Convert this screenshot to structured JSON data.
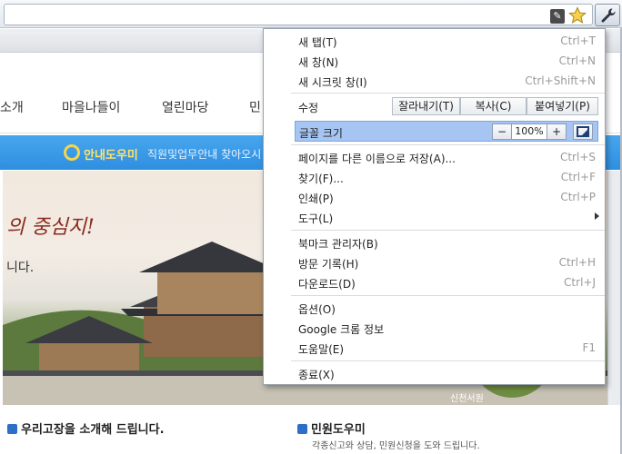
{
  "page": {
    "nav": [
      "소개",
      "마을나들이",
      "열린마당",
      "민"
    ],
    "guide_bar": {
      "title": "안내도우미",
      "links": "직원및업무안내 찾아오시"
    },
    "hero": {
      "slogan": "의 중심지!",
      "slogan2": "니다.",
      "caption": "신천서원"
    },
    "sections": [
      {
        "title": "우리고장을 소개해 드립니다."
      },
      {
        "title": "민원도우미",
        "desc": "각종신고와 상담, 민원신청을 도와 드립니다."
      }
    ]
  },
  "toolbar": {
    "page_action_icon": "page-action-icon",
    "star_icon": "bookmark-star-icon",
    "wrench_icon": "wrench-icon"
  },
  "menu": {
    "new_tab": {
      "label": "새 탭(T)",
      "shortcut": "Ctrl+T"
    },
    "new_window": {
      "label": "새 창(N)",
      "shortcut": "Ctrl+N"
    },
    "new_incognito": {
      "label": "새 시크릿 창(I)",
      "shortcut": "Ctrl+Shift+N"
    },
    "edit": {
      "label": "수정",
      "cut": "잘라내기(T)",
      "copy": "복사(C)",
      "paste": "붙여넣기(P)"
    },
    "zoom": {
      "label": "글꼴 크기",
      "minus": "−",
      "value": "100%",
      "plus": "+"
    },
    "save_as": {
      "label": "페이지를 다른 이름으로 저장(A)...",
      "shortcut": "Ctrl+S"
    },
    "find": {
      "label": "찾기(F)...",
      "shortcut": "Ctrl+F"
    },
    "print": {
      "label": "인쇄(P)",
      "shortcut": "Ctrl+P"
    },
    "tools": {
      "label": "도구(L)"
    },
    "bookmark_manager": {
      "label": "북마크 관리자(B)",
      "shortcut": ""
    },
    "history": {
      "label": "방문 기록(H)",
      "shortcut": "Ctrl+H"
    },
    "downloads": {
      "label": "다운로드(D)",
      "shortcut": "Ctrl+J"
    },
    "options": {
      "label": "옵션(O)",
      "shortcut": ""
    },
    "about": {
      "label": "Google 크롬 정보",
      "shortcut": ""
    },
    "help": {
      "label": "도움말(E)",
      "shortcut": "F1"
    },
    "exit": {
      "label": "종료(X)",
      "shortcut": ""
    }
  },
  "colors": {
    "zoom_row_highlight": "#a7c5f3",
    "guide_bar": "#3b9be8",
    "guide_title": "#ffe36a"
  }
}
